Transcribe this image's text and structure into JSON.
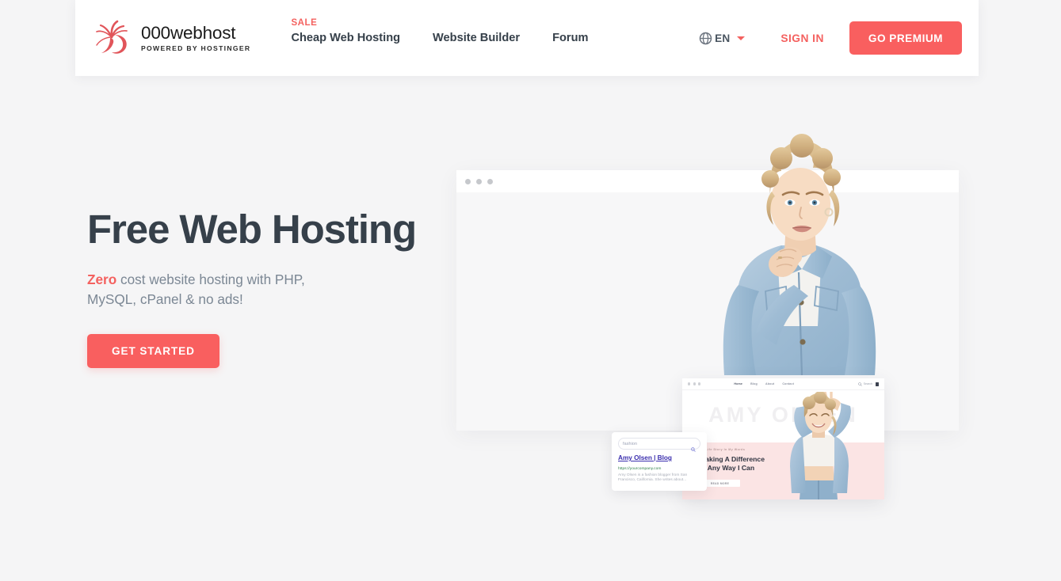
{
  "brand": {
    "name": "000webhost",
    "tagline": "POWERED BY HOSTINGER",
    "logo_icon": "swirl-logo-icon",
    "accent_color": "#f4615f"
  },
  "header": {
    "nav": [
      {
        "label": "Cheap Web Hosting",
        "badge": "SALE"
      },
      {
        "label": "Website Builder",
        "badge": ""
      },
      {
        "label": "Forum",
        "badge": ""
      }
    ],
    "language": {
      "icon": "globe-icon",
      "label": "EN",
      "caret_icon": "chevron-down-icon"
    },
    "sign_in_label": "SIGN IN",
    "premium_label": "GO PREMIUM"
  },
  "hero": {
    "title": "Free Web Hosting",
    "subtitle_accent": "Zero",
    "subtitle_rest": " cost website hosting with PHP, MySQL, cPanel & no ads!",
    "cta_label": "GET STARTED"
  },
  "mockup": {
    "search_card": {
      "search_value": "fashion",
      "search_icon": "magnifier-icon",
      "result_title": "Amy Olsen | Blog",
      "result_url": "https://yourcompany.com",
      "result_description": "Amy Olsen is a fashion blogger from San Francisco, California. She writes about..."
    },
    "blog_site": {
      "nav_items": [
        "Home",
        "Blog",
        "About",
        "Contact"
      ],
      "search_label": "Search",
      "cart_icon": "cart-icon",
      "watermark": "AMY OLSEN",
      "kicker": "My Life Story In My Words",
      "headline_line1": "Making A Difference",
      "headline_line2": "In Any Way I Can",
      "button_label": "READ MORE"
    }
  },
  "colors": {
    "page_background": "#f5f5f6",
    "brand_red": "#f4615f",
    "button_red": "#f95f5f",
    "heading_slate": "#36404a",
    "body_gray": "#7b8794",
    "link_indigo": "#3b2fae",
    "url_green": "#2a7d46",
    "pink_panel": "#fbe4e4"
  }
}
